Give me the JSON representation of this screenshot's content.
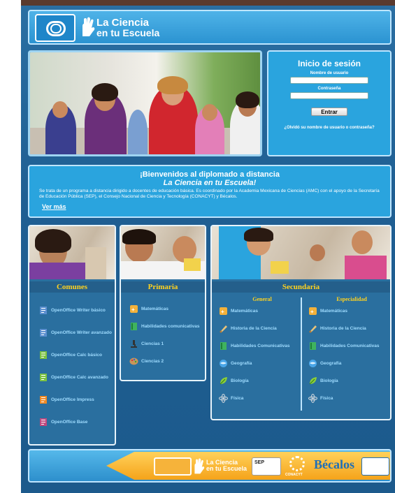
{
  "header": {
    "brand_line1": "La Ciencia",
    "brand_line2": "en tu Escuela"
  },
  "login": {
    "title": "Inicio de sesión",
    "username_label": "Nombre de usuario",
    "username_value": "",
    "password_label": "Contraseña",
    "password_value": "",
    "submit_label": "Entrar",
    "forgot_link": "¿Olvidó su nombre de usuario o contraseña?"
  },
  "welcome": {
    "title": "¡Bienvenidos al diplomado a distancia",
    "subtitle": "La Ciencia en tu Escuela!",
    "body": "Se trata de un programa a distancia dirigido a docentes de educación básica. Es coordinado por la Academia Mexicana de Ciencias (AMC) con el apoyo de la Secretaría de Educación Pública (SEP), el Consejo Nacional de Ciencia y Tecnología (CONACYT) y Bécalos.",
    "more_link": "Ver más"
  },
  "sections": {
    "comunes": {
      "title": "Comunes",
      "items": [
        {
          "label": "OpenOffice Writer básico",
          "icon": "openoffice-writer-icon",
          "color": "#5b8fcf"
        },
        {
          "label": "OpenOffice Writer avanzado",
          "icon": "openoffice-writer-icon",
          "color": "#5b8fcf"
        },
        {
          "label": "OpenOffice Calc básico",
          "icon": "openoffice-calc-icon",
          "color": "#7cc242"
        },
        {
          "label": "OpenOffice Calc avanzado",
          "icon": "openoffice-calc-icon",
          "color": "#7cc242"
        },
        {
          "label": "OpenOffice Impress",
          "icon": "openoffice-impress-icon",
          "color": "#f08a24"
        },
        {
          "label": "OpenOffice Base",
          "icon": "openoffice-base-icon",
          "color": "#c1497f"
        }
      ]
    },
    "primaria": {
      "title": "Primaria",
      "items": [
        {
          "label": "Matemáticas",
          "icon": "math-icon",
          "color": "#f3b13a"
        },
        {
          "label": "Habilidades comunicativas",
          "icon": "book-icon",
          "color": "#3fb35e"
        },
        {
          "label": "Ciencias 1",
          "icon": "microscope-icon",
          "color": "#333333"
        },
        {
          "label": "Ciencias 2",
          "icon": "palette-icon",
          "color": "#c9955a"
        }
      ]
    },
    "secundaria": {
      "title": "Secundaria",
      "general": {
        "title": "General",
        "items": [
          {
            "label": "Matemáticas",
            "icon": "math-icon",
            "color": "#f3b13a"
          },
          {
            "label": "Historia de la Ciencia",
            "icon": "scroll-icon",
            "color": "#e9c37a"
          },
          {
            "label": "Habilidades Comunicativas",
            "icon": "book-icon",
            "color": "#3fb35e"
          },
          {
            "label": "Geografía",
            "icon": "globe-icon",
            "color": "#4aa6e8"
          },
          {
            "label": "Biología",
            "icon": "leaf-icon",
            "color": "#8ccf3a"
          },
          {
            "label": "Física",
            "icon": "atom-icon",
            "color": "#cfd6dc"
          }
        ]
      },
      "especialidad": {
        "title": "Especialidad",
        "items": [
          {
            "label": "Matemáticas",
            "icon": "math-icon",
            "color": "#f3b13a"
          },
          {
            "label": "Historia de la Ciencia",
            "icon": "scroll-icon",
            "color": "#e9c37a"
          },
          {
            "label": "Habilidades Comunicativas",
            "icon": "book-icon",
            "color": "#3fb35e"
          },
          {
            "label": "Geografía",
            "icon": "globe-icon",
            "color": "#4aa6e8"
          },
          {
            "label": "Biología",
            "icon": "leaf-icon",
            "color": "#8ccf3a"
          },
          {
            "label": "Física",
            "icon": "atom-icon",
            "color": "#cfd6dc"
          }
        ]
      }
    }
  },
  "footer": {
    "brand_line1": "La Ciencia",
    "brand_line2": "en tu Escuela",
    "sep_label": "SEP",
    "conacyt_label": "CONACYT",
    "becalos_label": "Bécalos"
  },
  "colors": {
    "page_blue": "#1f5f93",
    "panel_blue": "#2aa4de",
    "section_title_yellow": "#ffd21f",
    "banner_orange": "#f5a31a"
  }
}
